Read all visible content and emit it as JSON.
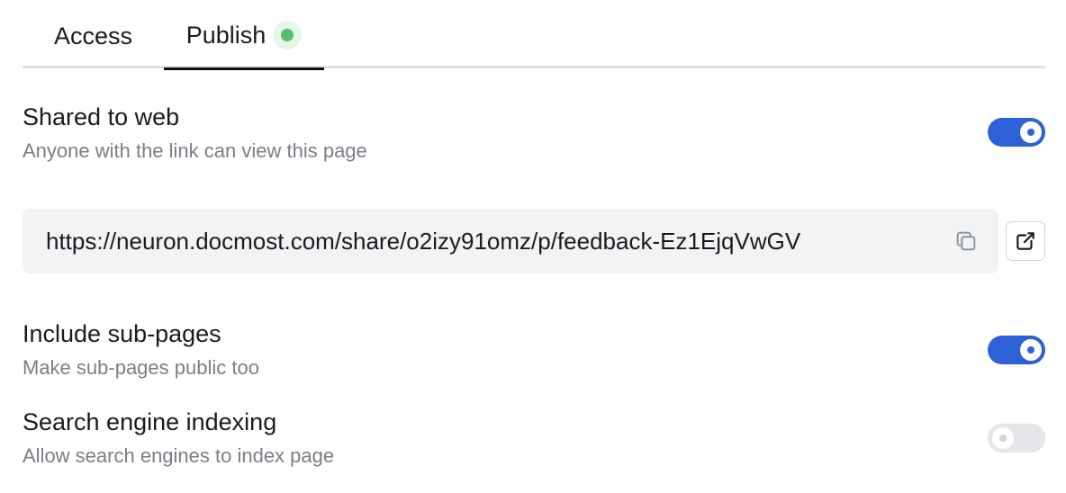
{
  "tabs": [
    {
      "label": "Access",
      "active": false
    },
    {
      "label": "Publish",
      "active": true,
      "status_color": "#51c16a"
    }
  ],
  "shared_to_web": {
    "title": "Shared to web",
    "description": "Anyone with the link can view this page",
    "enabled": true
  },
  "share_link": {
    "url": "https://neuron.docmost.com/share/o2izy91omz/p/feedback-Ez1EjqVwGV",
    "copy_icon": "copy-icon",
    "open_icon": "external-link-icon"
  },
  "include_sub_pages": {
    "title": "Include sub-pages",
    "description": "Make sub-pages public too",
    "enabled": true
  },
  "search_engine_indexing": {
    "title": "Search engine indexing",
    "description": "Allow search engines to index page",
    "enabled": false
  },
  "colors": {
    "accent": "#2c62d6",
    "status_green": "#51c16a",
    "muted_text": "#7a7f86"
  }
}
